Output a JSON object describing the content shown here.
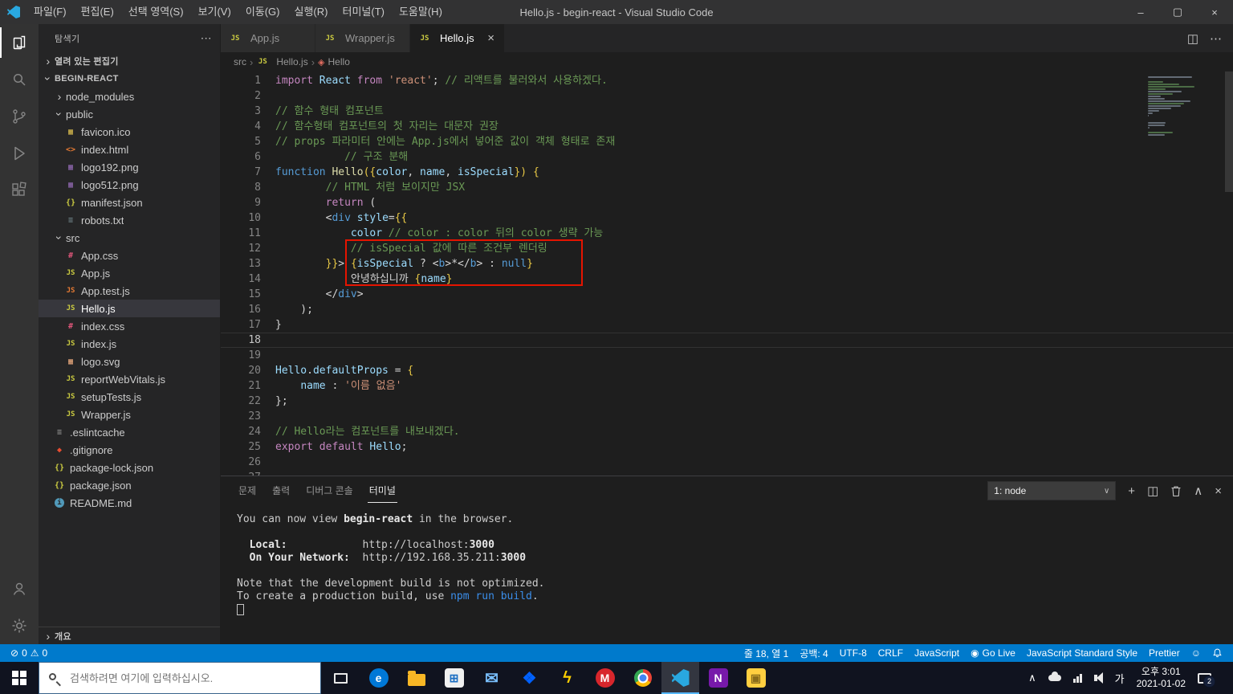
{
  "colors": {
    "accent": "#007acc",
    "titlebar_bg": "#323233",
    "activitybar_bg": "#333333",
    "sidebar_bg": "#252526",
    "editor_bg": "#1e1e1e",
    "statusbar_bg": "#007acc",
    "taskbar_bg": "#10131f",
    "highlight_box": "#e51400"
  },
  "titlebar": {
    "menus": [
      "파일(F)",
      "편집(E)",
      "선택 영역(S)",
      "보기(V)",
      "이동(G)",
      "실행(R)",
      "터미널(T)",
      "도움말(H)"
    ],
    "title": "Hello.js - begin-react - Visual Studio Code"
  },
  "sidebar": {
    "title": "탐색기",
    "open_editors_label": "열려 있는 편집기",
    "project_label": "BEGIN-REACT",
    "outline_label": "개요",
    "tree": [
      {
        "label": "node_modules",
        "kind": "folder",
        "expanded": false,
        "indent": 1
      },
      {
        "label": "public",
        "kind": "folder",
        "expanded": true,
        "indent": 1
      },
      {
        "label": "favicon.ico",
        "icon": "img",
        "color": "#d7ba4d",
        "indent": 2
      },
      {
        "label": "index.html",
        "icon": "html",
        "color": "#e37933",
        "indent": 2
      },
      {
        "label": "logo192.png",
        "icon": "img",
        "color": "#9068b0",
        "indent": 2
      },
      {
        "label": "logo512.png",
        "icon": "img",
        "color": "#9068b0",
        "indent": 2
      },
      {
        "label": "manifest.json",
        "icon": "json",
        "color": "#cbcb41",
        "indent": 2
      },
      {
        "label": "robots.txt",
        "icon": "txt",
        "color": "#6d8086",
        "indent": 2
      },
      {
        "label": "src",
        "kind": "folder",
        "expanded": true,
        "indent": 1
      },
      {
        "label": "App.css",
        "icon": "css",
        "color": "#e0567a",
        "indent": 2
      },
      {
        "label": "App.js",
        "icon": "js",
        "color": "#cbcb41",
        "indent": 2
      },
      {
        "label": "App.test.js",
        "icon": "js",
        "color": "#e37933",
        "indent": 2
      },
      {
        "label": "Hello.js",
        "icon": "js",
        "color": "#cbcb41",
        "indent": 2,
        "selected": true
      },
      {
        "label": "index.css",
        "icon": "css",
        "color": "#e0567a",
        "indent": 2
      },
      {
        "label": "index.js",
        "icon": "js",
        "color": "#cbcb41",
        "indent": 2
      },
      {
        "label": "logo.svg",
        "icon": "img",
        "color": "#e8a87c",
        "indent": 2
      },
      {
        "label": "reportWebVitals.js",
        "icon": "js",
        "color": "#cbcb41",
        "indent": 2
      },
      {
        "label": "setupTests.js",
        "icon": "js",
        "color": "#cbcb41",
        "indent": 2
      },
      {
        "label": "Wrapper.js",
        "icon": "js",
        "color": "#cbcb41",
        "indent": 2
      },
      {
        "label": ".eslintcache",
        "icon": "txt",
        "color": "#8a8a8a",
        "indent": 1
      },
      {
        "label": ".gitignore",
        "icon": "git",
        "color": "#e84d31",
        "indent": 1
      },
      {
        "label": "package-lock.json",
        "icon": "json",
        "color": "#cbcb41",
        "indent": 1
      },
      {
        "label": "package.json",
        "icon": "json",
        "color": "#cbcb41",
        "indent": 1
      },
      {
        "label": "README.md",
        "icon": "info",
        "color": "#519aba",
        "indent": 1
      }
    ]
  },
  "icon_glyphs": {
    "js": "JS",
    "css": "#",
    "html": "<>",
    "json": "{}",
    "img": "▦",
    "txt": "≡",
    "git": "◆",
    "info": "i"
  },
  "editor": {
    "tabs": [
      {
        "label": "App.js",
        "active": false
      },
      {
        "label": "Wrapper.js",
        "active": false
      },
      {
        "label": "Hello.js",
        "active": true
      }
    ],
    "breadcrumb": [
      "src",
      "Hello.js",
      "Hello"
    ],
    "current_line": 18,
    "code_lines": [
      [
        [
          "import",
          "k"
        ],
        [
          " ",
          "p"
        ],
        [
          "React",
          "v"
        ],
        [
          " ",
          "p"
        ],
        [
          "from",
          "k"
        ],
        [
          " ",
          "p"
        ],
        [
          "'react'",
          "s"
        ],
        [
          "; ",
          "p"
        ],
        [
          "// 리액트를 불러와서 사용하겠다.",
          "c"
        ]
      ],
      [],
      [
        [
          "// 함수 형태 컴포넌트",
          "c"
        ]
      ],
      [
        [
          "// 함수형태 컴포넌트의 첫 자리는 대문자 권장",
          "c"
        ]
      ],
      [
        [
          "// props 파라미터 안에는 App.js에서 넣어준 값이 객체 형태로 존재",
          "c"
        ]
      ],
      [
        [
          "           ",
          "p"
        ],
        [
          "// 구조 분해",
          "c"
        ]
      ],
      [
        [
          "function",
          "b"
        ],
        [
          " ",
          "p"
        ],
        [
          "Hello",
          "f"
        ],
        [
          "({",
          "g"
        ],
        [
          "color",
          "v"
        ],
        [
          ", ",
          "p"
        ],
        [
          "name",
          "v"
        ],
        [
          ", ",
          "p"
        ],
        [
          "isSpecial",
          "v"
        ],
        [
          "})",
          "g"
        ],
        [
          " ",
          "p"
        ],
        [
          "{",
          "g"
        ]
      ],
      [
        [
          "        ",
          "p"
        ],
        [
          "// HTML 처럼 보이지만 JSX",
          "c"
        ]
      ],
      [
        [
          "        ",
          "p"
        ],
        [
          "return",
          "k"
        ],
        [
          " (",
          "p"
        ]
      ],
      [
        [
          "        <",
          "p"
        ],
        [
          "div",
          "t"
        ],
        [
          " ",
          "p"
        ],
        [
          "style",
          "v"
        ],
        [
          "=",
          "p"
        ],
        [
          "{{",
          "g"
        ]
      ],
      [
        [
          "            ",
          "p"
        ],
        [
          "color",
          "v"
        ],
        [
          " ",
          "p"
        ],
        [
          "// color : color 뒤의 color 생략 가능",
          "c"
        ]
      ],
      [
        [
          "            ",
          "p"
        ],
        [
          "// isSpecial 값에 따른 조건부 렌더링",
          "c"
        ]
      ],
      [
        [
          "        ",
          "p"
        ],
        [
          "}}",
          "g"
        ],
        [
          "> ",
          "p"
        ],
        [
          "{",
          "g"
        ],
        [
          "isSpecial",
          "v"
        ],
        [
          " ? ",
          "p"
        ],
        [
          "<",
          "p"
        ],
        [
          "b",
          "t"
        ],
        [
          ">",
          "p"
        ],
        [
          "*",
          "w"
        ],
        [
          "</",
          "p"
        ],
        [
          "b",
          "t"
        ],
        [
          "> : ",
          "p"
        ],
        [
          "null",
          "b"
        ],
        [
          "}",
          "g"
        ]
      ],
      [
        [
          "            ",
          "p"
        ],
        [
          "안녕하십니까 ",
          "w"
        ],
        [
          "{",
          "g"
        ],
        [
          "name",
          "v"
        ],
        [
          "}",
          "g"
        ]
      ],
      [
        [
          "        </",
          "p"
        ],
        [
          "div",
          "t"
        ],
        [
          ">",
          "p"
        ]
      ],
      [
        [
          "    );",
          "p"
        ]
      ],
      [
        [
          "}",
          "p"
        ]
      ],
      [],
      [],
      [
        [
          "Hello",
          "v"
        ],
        [
          ".",
          "p"
        ],
        [
          "defaultProps",
          "v"
        ],
        [
          " = ",
          "p"
        ],
        [
          "{",
          "g"
        ]
      ],
      [
        [
          "    ",
          "p"
        ],
        [
          "name",
          "v"
        ],
        [
          " : ",
          "p"
        ],
        [
          "'이름 없음'",
          "s"
        ]
      ],
      [
        [
          "};",
          "p"
        ]
      ],
      [],
      [
        [
          "// Hello라는 컴포넌트를 내보내겠다.",
          "c"
        ]
      ],
      [
        [
          "export",
          "k"
        ],
        [
          " ",
          "p"
        ],
        [
          "default",
          "k"
        ],
        [
          " ",
          "p"
        ],
        [
          "Hello",
          "v"
        ],
        [
          ";",
          "p"
        ]
      ],
      [],
      []
    ]
  },
  "panel": {
    "tabs": [
      "문제",
      "출력",
      "디버그 콘솔",
      "터미널"
    ],
    "active_tab": "터미널",
    "shell_selector": "1: node",
    "terminal_lines": [
      [
        [
          "You can now view ",
          "n"
        ],
        [
          "begin-react",
          "nb"
        ],
        [
          " in the browser.",
          "n"
        ]
      ],
      [],
      [
        [
          "  ",
          "n"
        ],
        [
          "Local:",
          "nb"
        ],
        [
          "            ",
          "n"
        ],
        [
          "http://localhost:",
          "n"
        ],
        [
          "3000",
          "nb"
        ]
      ],
      [
        [
          "  ",
          "n"
        ],
        [
          "On Your Network:",
          "nb"
        ],
        [
          "  ",
          "n"
        ],
        [
          "http://192.168.35.211:",
          "n"
        ],
        [
          "3000",
          "nb"
        ]
      ],
      [],
      [
        [
          "Note that the development build is not optimized.",
          "n"
        ]
      ],
      [
        [
          "To create a production build, use ",
          "n"
        ],
        [
          "npm run build",
          "cmd"
        ],
        [
          ".",
          "n"
        ]
      ]
    ]
  },
  "statusbar": {
    "errors": "0",
    "warnings": "0",
    "items_right": [
      {
        "name": "cursor-position",
        "label": "줄 18, 열 1"
      },
      {
        "name": "indentation",
        "label": "공백: 4"
      },
      {
        "name": "encoding",
        "label": "UTF-8"
      },
      {
        "name": "eol",
        "label": "CRLF"
      },
      {
        "name": "language-mode",
        "label": "JavaScript"
      },
      {
        "name": "go-live",
        "label": "Go Live",
        "icon": "broadcast"
      },
      {
        "name": "js-standard-style",
        "label": "JavaScript Standard Style"
      },
      {
        "name": "prettier",
        "label": "Prettier"
      }
    ]
  },
  "taskbar": {
    "search_placeholder": "검색하려면 여기에 입력하십시오.",
    "ime": "가",
    "time": "오후 3:01",
    "date": "2021-01-02",
    "notification_count": "2",
    "apps": [
      {
        "name": "edge",
        "glyph": "e",
        "bg": "#0078d7",
        "fg": "#ffffff",
        "shape": "circle"
      },
      {
        "name": "file-explorer",
        "shape": "folder"
      },
      {
        "name": "store",
        "glyph": "⊞",
        "bg": "#f0f0f0",
        "fg": "#1b6ec2"
      },
      {
        "name": "mail",
        "glyph": "✉",
        "fg": "#7ac0ff",
        "shape": "flat"
      },
      {
        "name": "dropbox",
        "glyph": "❖",
        "fg": "#0061fe",
        "shape": "flat"
      },
      {
        "name": "lightning-app",
        "glyph": "ϟ",
        "fg": "#ffd000",
        "shape": "flat"
      },
      {
        "name": "security-app",
        "glyph": "M",
        "bg": "#d8262c",
        "fg": "#ffffff",
        "shape": "circle"
      },
      {
        "name": "chrome",
        "shape": "chrome"
      },
      {
        "name": "vscode",
        "shape": "vscode",
        "active": true
      },
      {
        "name": "onenote",
        "glyph": "N",
        "bg": "#7719aa",
        "fg": "#ffffff"
      },
      {
        "name": "yellow-app",
        "glyph": "▣",
        "bg": "#ffcf40",
        "fg": "#8a6d1a"
      }
    ]
  }
}
